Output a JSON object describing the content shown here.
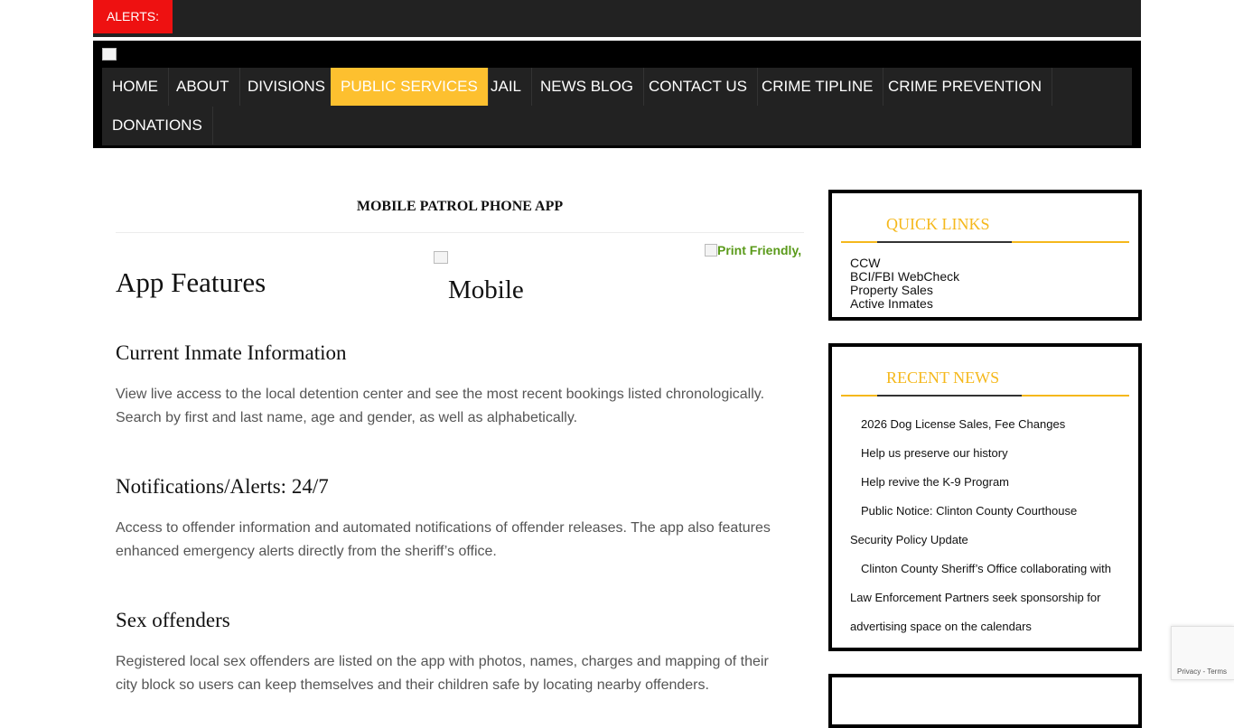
{
  "alerts": {
    "label": "ALERTS:"
  },
  "nav": {
    "items": [
      {
        "label": "HOME"
      },
      {
        "label": "ABOUT"
      },
      {
        "label": "DIVISIONS"
      },
      {
        "label": "PUBLIC SERVICES",
        "active": true
      },
      {
        "label": "JAIL"
      },
      {
        "label": "NEWS BLOG"
      },
      {
        "label": "CONTACT US"
      },
      {
        "label": "CRIME TIPLINE"
      },
      {
        "label": "CRIME PREVENTION"
      },
      {
        "label": "DONATIONS"
      }
    ]
  },
  "page": {
    "title": "MOBILE PATROL PHONE APP",
    "print_label": "Print Friendly,",
    "image_alt": "Mobile",
    "heading": "App Features",
    "sections": [
      {
        "heading": "Current Inmate Information",
        "body": "View live access to the local detention center and see the most recent bookings listed chronologically. Search by first and last name, age and gender, as well as alphabetically."
      },
      {
        "heading": "Notifications/Alerts: 24/7",
        "body": "Access to offender information and automated notifications of offender releases. The app also features enhanced emergency alerts directly from the sheriff’s office."
      },
      {
        "heading": "Sex offenders",
        "body": "Registered local sex offenders are listed on the app with photos, names, charges and mapping of their city block so users can keep themselves and their children safe by locating nearby offenders."
      }
    ]
  },
  "sidebar": {
    "quick_links": {
      "title": "QUICK LINKS",
      "items": [
        "CCW",
        "BCI/FBI WebCheck",
        "Property Sales",
        "Active Inmates"
      ]
    },
    "recent_news": {
      "title": "RECENT NEWS",
      "items": [
        "2026 Dog License Sales, Fee Changes",
        "Help us preserve our history",
        "Help revive the K-9 Program",
        "Public Notice: Clinton County Courthouse Security Policy Update",
        "Clinton County Sheriff’s Office collaborating with Law Enforcement Partners seek sponsorship for advertising space on the calendars"
      ]
    }
  },
  "recaptcha": {
    "privacy": "Privacy",
    "separator": " - ",
    "terms": "Terms"
  },
  "colors": {
    "accent": "#fdc02f",
    "alert": "#ee1111",
    "nav_bg": "#222222",
    "widget_title": "#f5b81c",
    "print_link": "#5a9a1a"
  }
}
